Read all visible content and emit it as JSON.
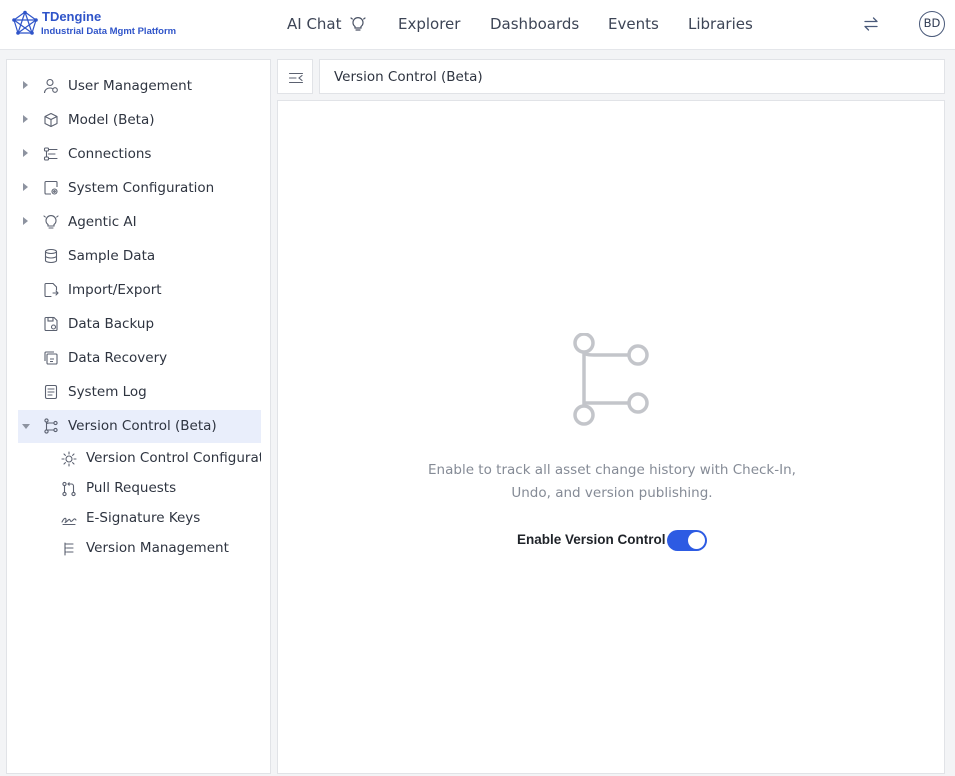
{
  "app": {
    "name": "TDengine",
    "tagline": "Industrial Data Mgmt Platform"
  },
  "header": {
    "nav": [
      {
        "label": "AI Chat",
        "icon": "bulb-icon"
      },
      {
        "label": "Explorer"
      },
      {
        "label": "Dashboards"
      },
      {
        "label": "Events"
      },
      {
        "label": "Libraries"
      }
    ],
    "switch_icon": "swap-arrows-icon",
    "avatar_initials": "BD"
  },
  "sidebar": {
    "items": [
      {
        "label": "User Management",
        "icon": "user-gear-icon",
        "expandable": true
      },
      {
        "label": "Model (Beta)",
        "icon": "cube-icon",
        "expandable": true
      },
      {
        "label": "Connections",
        "icon": "connections-icon",
        "expandable": true
      },
      {
        "label": "System Configuration",
        "icon": "system-config-icon",
        "expandable": true
      },
      {
        "label": "Agentic AI",
        "icon": "bulb-icon",
        "expandable": true
      },
      {
        "label": "Sample Data",
        "icon": "database-icon",
        "expandable": false
      },
      {
        "label": "Import/Export",
        "icon": "import-export-icon",
        "expandable": false
      },
      {
        "label": "Data Backup",
        "icon": "backup-icon",
        "expandable": false
      },
      {
        "label": "Data Recovery",
        "icon": "recovery-icon",
        "expandable": false
      },
      {
        "label": "System Log",
        "icon": "log-icon",
        "expandable": false
      },
      {
        "label": "Version Control (Beta)",
        "icon": "branch-icon",
        "expandable": true,
        "expanded": true,
        "selected": true
      }
    ],
    "sub_items": [
      {
        "label": "Version Control Configuration",
        "icon": "sun-gear-icon"
      },
      {
        "label": "Pull Requests",
        "icon": "pull-request-icon"
      },
      {
        "label": "E-Signature Keys",
        "icon": "signature-icon"
      },
      {
        "label": "Version Management",
        "icon": "version-list-icon"
      }
    ]
  },
  "breadcrumb": {
    "collapse_icon": "collapse-sidebar-icon",
    "title": "Version Control (Beta)"
  },
  "main": {
    "illustration_icon": "branch-icon",
    "description": "Enable to track all asset change history with Check-In, Undo, and version publishing.",
    "toggle_label": "Enable Version Control",
    "toggle_on": true
  },
  "colors": {
    "accent": "#2d5be3",
    "brand": "#2f54c9",
    "selected_bg": "#e9eefb",
    "muted_text": "#858b96"
  }
}
